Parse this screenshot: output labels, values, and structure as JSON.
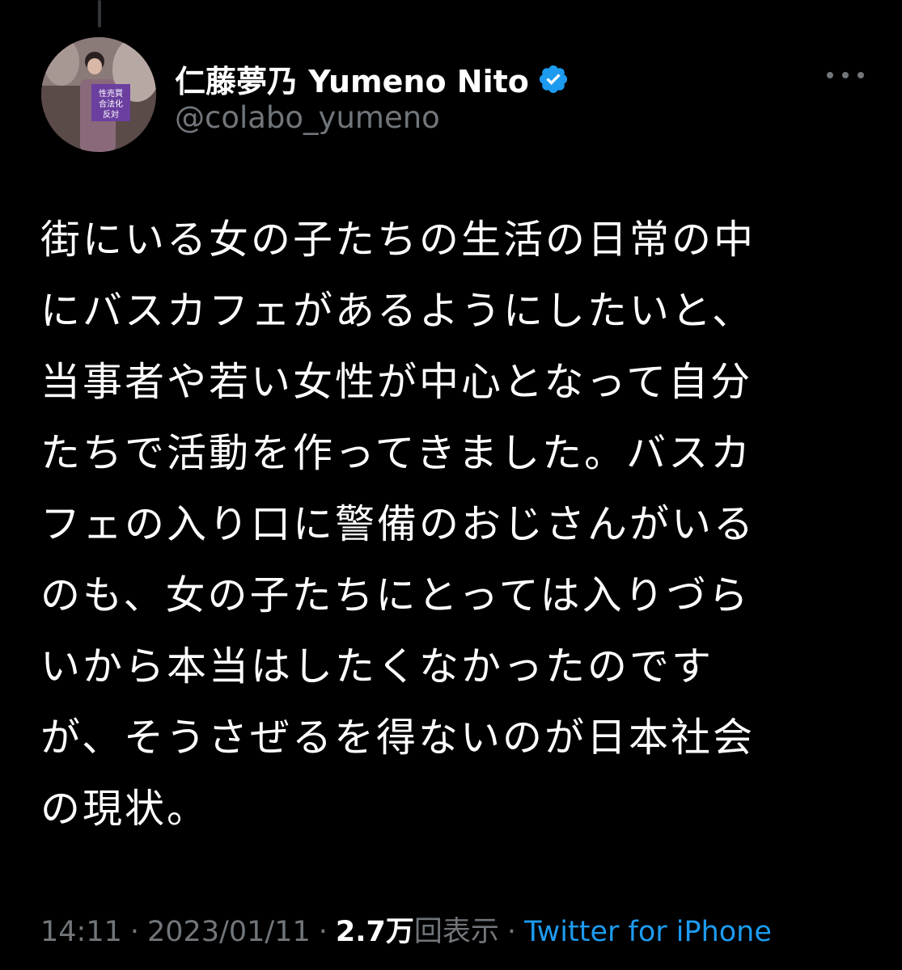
{
  "author": {
    "display_name": "仁藤夢乃  Yumeno Nito",
    "handle": "@colabo_yumeno",
    "verified": true,
    "avatar_sign_lines": [
      "性売買",
      "合法化",
      "反対"
    ]
  },
  "tweet": {
    "text": "街にいる女の子たちの生活の日常の中\nにバスカフェがあるようにしたいと、\n当事者や若い女性が中心となって自分\nたちで活動を作ってきました。バスカ\nフェの入り口に警備のおじさんがいる\nのも、女の子たちにとっては入りづら\nいから本当はしたくなかったのです\nが、そうさぜるを得ないのが日本社会\nの現状。"
  },
  "meta": {
    "time": "14:11",
    "separator": "·",
    "date": "2023/01/11",
    "views_count": "2.7万",
    "views_label": "回表示",
    "source": "Twitter for iPhone"
  },
  "colors": {
    "background": "#000000",
    "secondary_text": "#71767b",
    "link": "#1d9bf0",
    "verified_badge": "#1d9bf0"
  },
  "icons": {
    "verified": "verified-badge-icon",
    "more": "more-options-icon"
  }
}
